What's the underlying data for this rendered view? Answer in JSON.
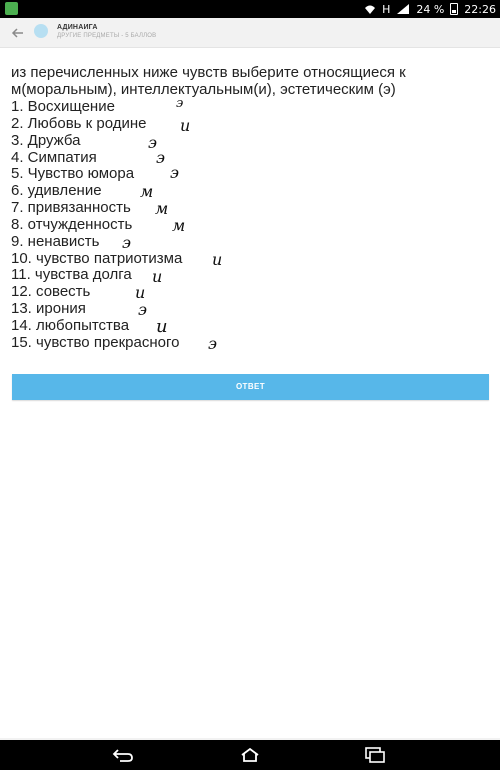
{
  "status_bar": {
    "network_label": "H",
    "battery_percent": "24 %",
    "time": "22:26"
  },
  "header": {
    "username": "АДИНАИГА",
    "subject": "ДРУГИЕ ПРЕДМЕТЫ - 5 БАЛЛОВ"
  },
  "question": {
    "text": "из перечисленных ниже чувств выберите относящиеся к м(моральным), интеллектуальным(и), эстетическим (э)",
    "items": [
      {
        "label": "1. Восхищение",
        "mark": "э"
      },
      {
        "label": "2. Любовь к родине",
        "mark": "и"
      },
      {
        "label": "3. Дружба",
        "mark": "э"
      },
      {
        "label": "4. Симпатия",
        "mark": "э"
      },
      {
        "label": "5. Чувство юмора",
        "mark": "э"
      },
      {
        "label": "6. удивление",
        "mark": "м"
      },
      {
        "label": "7. привязанность",
        "mark": "м"
      },
      {
        "label": "8. отчужденность",
        "mark": "м"
      },
      {
        "label": "9. ненависть",
        "mark": "э"
      },
      {
        "label": "10. чувство патриотизма",
        "mark": "и"
      },
      {
        "label": "11. чувства долга",
        "mark": "и"
      },
      {
        "label": "12. совесть",
        "mark": "и"
      },
      {
        "label": "13. ирония",
        "mark": "э"
      },
      {
        "label": "14. любопытства",
        "mark": "и"
      },
      {
        "label": "15. чувство прекрасного",
        "mark": "э"
      }
    ]
  },
  "answer_button": {
    "label": "ОТВЕТ"
  },
  "colors": {
    "accent": "#57b7e9",
    "status_bar": "#000000",
    "nav_bar": "#000000"
  },
  "icons": {
    "back": "arrow-left-icon",
    "avatar": "avatar-icon",
    "wifi": "wifi-icon",
    "signal": "signal-icon",
    "battery": "battery-icon",
    "nav_back": "nav-back-icon",
    "nav_home": "nav-home-icon",
    "nav_recent": "nav-recent-icon"
  }
}
